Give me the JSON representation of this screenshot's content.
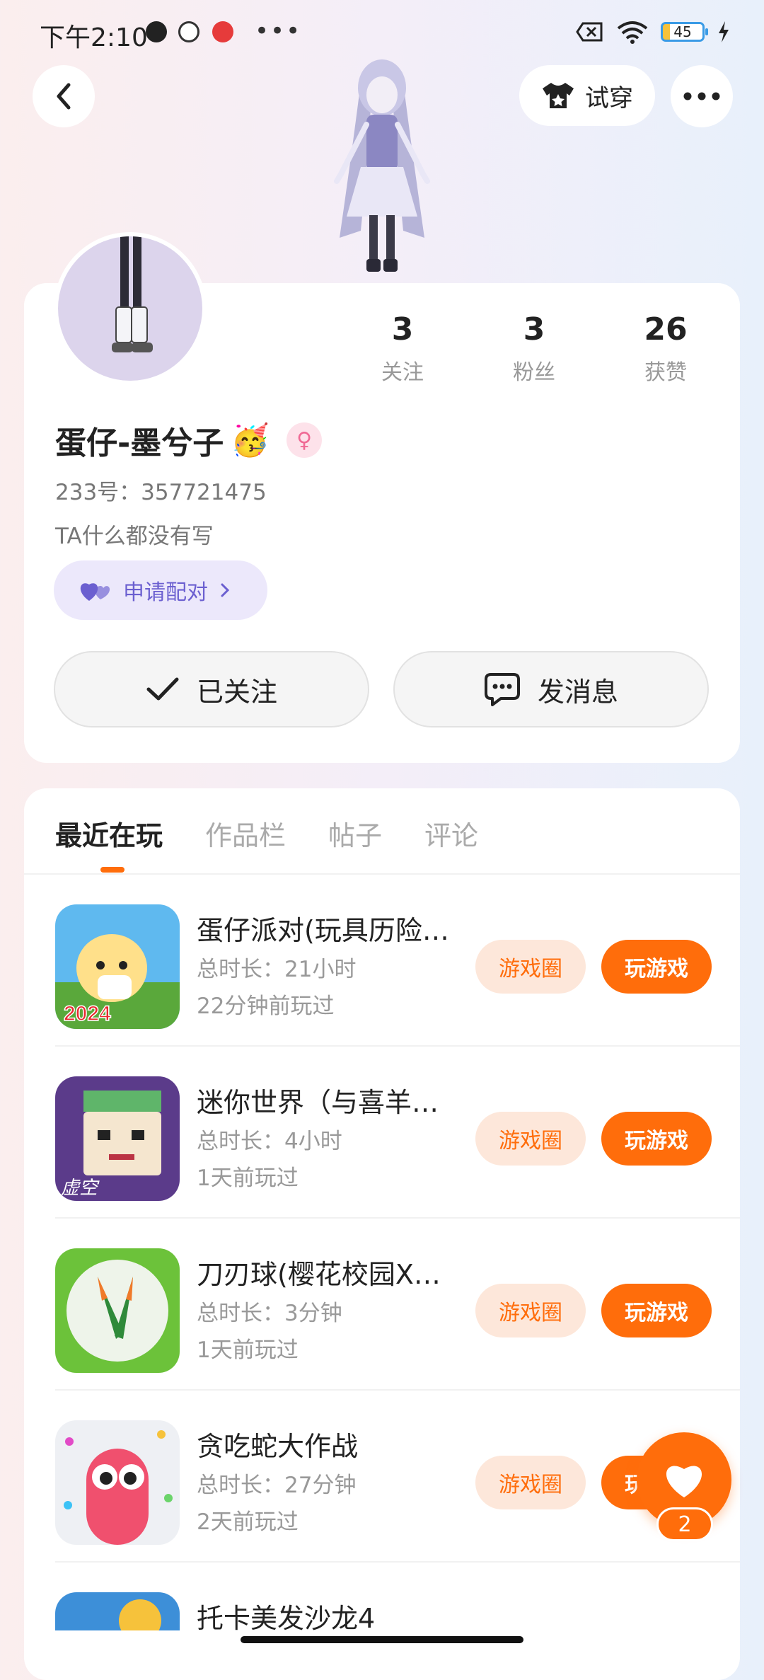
{
  "status": {
    "time": "下午2:10",
    "battery": "45"
  },
  "nav": {
    "tryon_label": "试穿"
  },
  "profile": {
    "stats": [
      {
        "num": "3",
        "label": "关注"
      },
      {
        "num": "3",
        "label": "粉丝"
      },
      {
        "num": "26",
        "label": "获赞"
      }
    ],
    "nickname": "蛋仔-墨兮子",
    "nickname_emoji": "🥳",
    "gender_symbol": "♀",
    "uid": "233号：357721475",
    "bio": "TA什么都没有写",
    "pair_label": "申请配对",
    "follow_label": "已关注",
    "message_label": "发消息"
  },
  "tabs": [
    "最近在玩",
    "作品栏",
    "帖子",
    "评论"
  ],
  "games": [
    {
      "title": "蛋仔派对(玩具历险…",
      "duration": "总时长：21小时",
      "last": "22分钟前玩过",
      "circle_label": "游戏圈",
      "play_label": "玩游戏"
    },
    {
      "title": "迷你世界（与喜羊…",
      "duration": "总时长：4小时",
      "last": "1天前玩过",
      "circle_label": "游戏圈",
      "play_label": "玩游戏"
    },
    {
      "title": "刀刃球(樱花校园X…",
      "duration": "总时长：3分钟",
      "last": "1天前玩过",
      "circle_label": "游戏圈",
      "play_label": "玩游戏"
    },
    {
      "title": "贪吃蛇大作战",
      "duration": "总时长：27分钟",
      "last": "2天前玩过",
      "circle_label": "游戏圈",
      "play_label": "玩游戏"
    },
    {
      "title": "托卡美发沙龙4",
      "duration": "",
      "last": "",
      "circle_label": "",
      "play_label": ""
    }
  ],
  "fab": {
    "count": "2"
  },
  "icon_badges": {
    "game1": "2024",
    "game2": "虚空"
  }
}
